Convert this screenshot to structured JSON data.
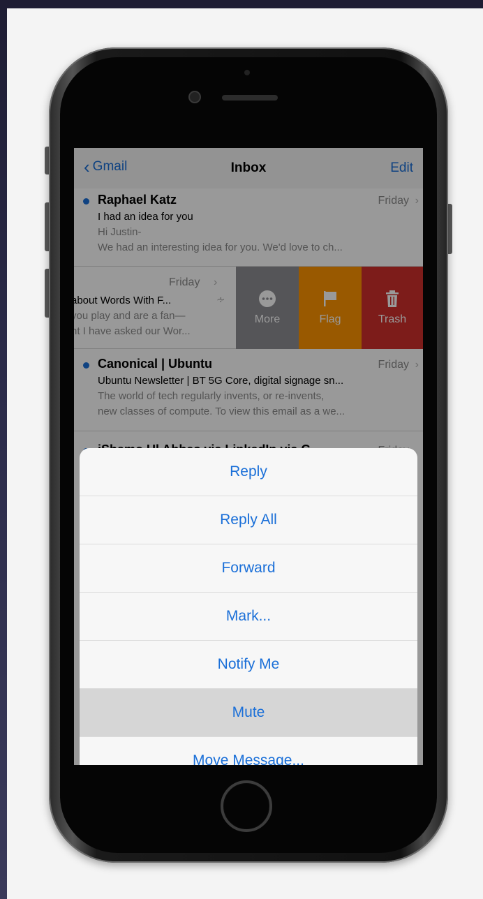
{
  "navbar": {
    "back": "Gmail",
    "title": "Inbox",
    "edit": "Edit"
  },
  "emails": [
    {
      "sender": "Raphael Katz",
      "date": "Friday",
      "subject": "I had an idea for you",
      "preview_1": "Hi Justin-",
      "preview_2": "We had an interesting idea for you. We'd love to ch..."
    },
    {
      "date": "Friday",
      "subject": "about Words With F...",
      "preview_1": "you play and are a fan—",
      "preview_2": "nt I have asked our Wor..."
    },
    {
      "sender": "Canonical | Ubuntu",
      "date": "Friday",
      "subject": "Ubuntu Newsletter | BT 5G Core, digital signage sn...",
      "preview_1": "The world of tech regularly invents, or re-invents,",
      "preview_2": "new classes of compute. To view this email as a we..."
    },
    {
      "sender": "iShamo Ul Abbas via LinkedIn via C...",
      "date": "Friday"
    }
  ],
  "swipe_actions": [
    {
      "label": "More",
      "icon": "more-icon",
      "color": "#8e8e93"
    },
    {
      "label": "Flag",
      "icon": "flag-icon",
      "color": "#ff9500"
    },
    {
      "label": "Trash",
      "icon": "trash-icon",
      "color": "#d0302c"
    }
  ],
  "action_sheet": {
    "items": [
      "Reply",
      "Reply All",
      "Forward",
      "Mark...",
      "Notify Me",
      "Mute",
      "Move Message..."
    ],
    "highlighted": "Mute"
  },
  "colors": {
    "accent": "#1a6fd8",
    "unread_dot": "#1a6fd8"
  }
}
